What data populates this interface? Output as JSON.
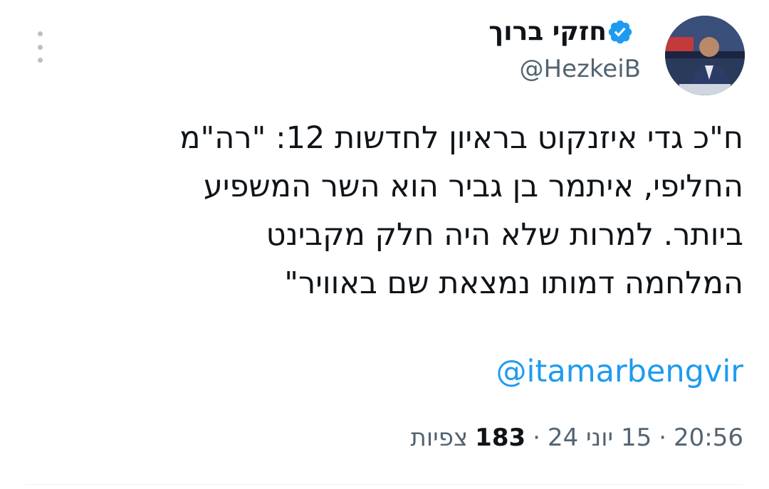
{
  "author": {
    "display_name": "חזקי ברוך",
    "handle": "@HezkeiB",
    "verified": true,
    "verified_color": "#1d9bf0"
  },
  "tweet": {
    "lines": [
      "ח\"כ גדי איזנקוט בראיון לחדשות 12: \"רה\"מ",
      "החליפי, איתמר בן גביר הוא השר המשפיע",
      "ביותר. למרות שלא היה חלק מקבינט",
      "המלחמה דמותו נמצאת שם באוויר\""
    ],
    "mention": "@itamarbengvir",
    "mention_color": "#1d9bf0"
  },
  "meta": {
    "time": "20:56",
    "date": "15 יוני 24",
    "separator": "·",
    "views_count": "183",
    "views_label": "צפיות"
  },
  "icons": {
    "avatar": "avatar-photo",
    "verified": "verified-badge-icon",
    "more": "more-options-icon"
  }
}
